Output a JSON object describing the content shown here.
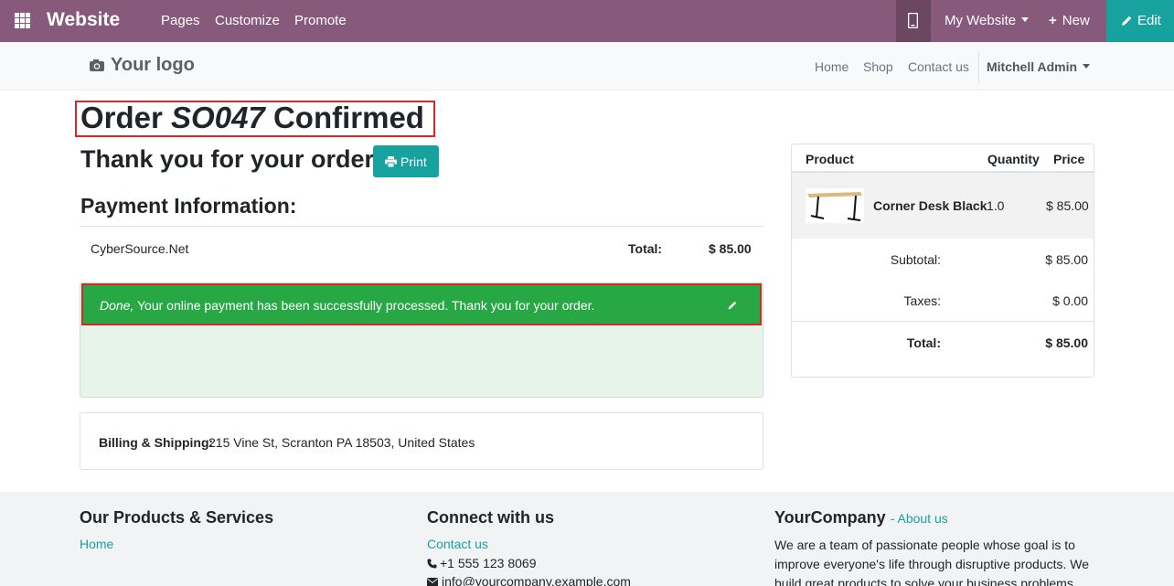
{
  "adminbar": {
    "brand": "Website",
    "menu": [
      "Pages",
      "Customize",
      "Promote"
    ],
    "my_website": "My Website",
    "new_label": "New",
    "edit_label": "Edit",
    "color": "#875a7b"
  },
  "header": {
    "logo": "Your logo",
    "nav": [
      "Home",
      "Shop",
      "Contact us"
    ],
    "user": "Mitchell Admin"
  },
  "order": {
    "title_prefix": "Order",
    "order_ref": "SO047",
    "title_suffix": "Confirmed",
    "thanks": "Thank you for your order.",
    "print_label": "Print"
  },
  "payment": {
    "heading": "Payment Information:",
    "acquirer": "CyberSource.Net",
    "total_label": "Total:",
    "total_value": "$ 85.00",
    "status_done": "Done,",
    "status_message": "Your online payment has been successfully processed. Thank you for your order."
  },
  "billing": {
    "label": "Billing & Shipping:",
    "address": "215 Vine St, Scranton PA 18503, United States"
  },
  "summary": {
    "headers": {
      "product": "Product",
      "quantity": "Quantity",
      "price": "Price"
    },
    "line": {
      "name": "Corner Desk Black",
      "qty": "1.0",
      "price": "$ 85.00"
    },
    "subtotal_label": "Subtotal:",
    "subtotal_value": "$ 85.00",
    "taxes_label": "Taxes:",
    "taxes_value": "$ 0.00",
    "total_label": "Total:",
    "total_value": "$ 85.00"
  },
  "footer": {
    "products_heading": "Our Products & Services",
    "products_link": "Home",
    "connect_heading": "Connect with us",
    "contact_link": "Contact us",
    "phone": "+1 555 123 8069",
    "email": "info@yourcompany.example.com",
    "company": "YourCompany",
    "about_link": "About us",
    "description": "We are a team of passionate people whose goal is to improve everyone's life through disruptive products. We build great products to solve your business problems."
  },
  "colors": {
    "accent": "#17a2a0",
    "success": "#28a745",
    "highlight_border": "#d9262a"
  }
}
